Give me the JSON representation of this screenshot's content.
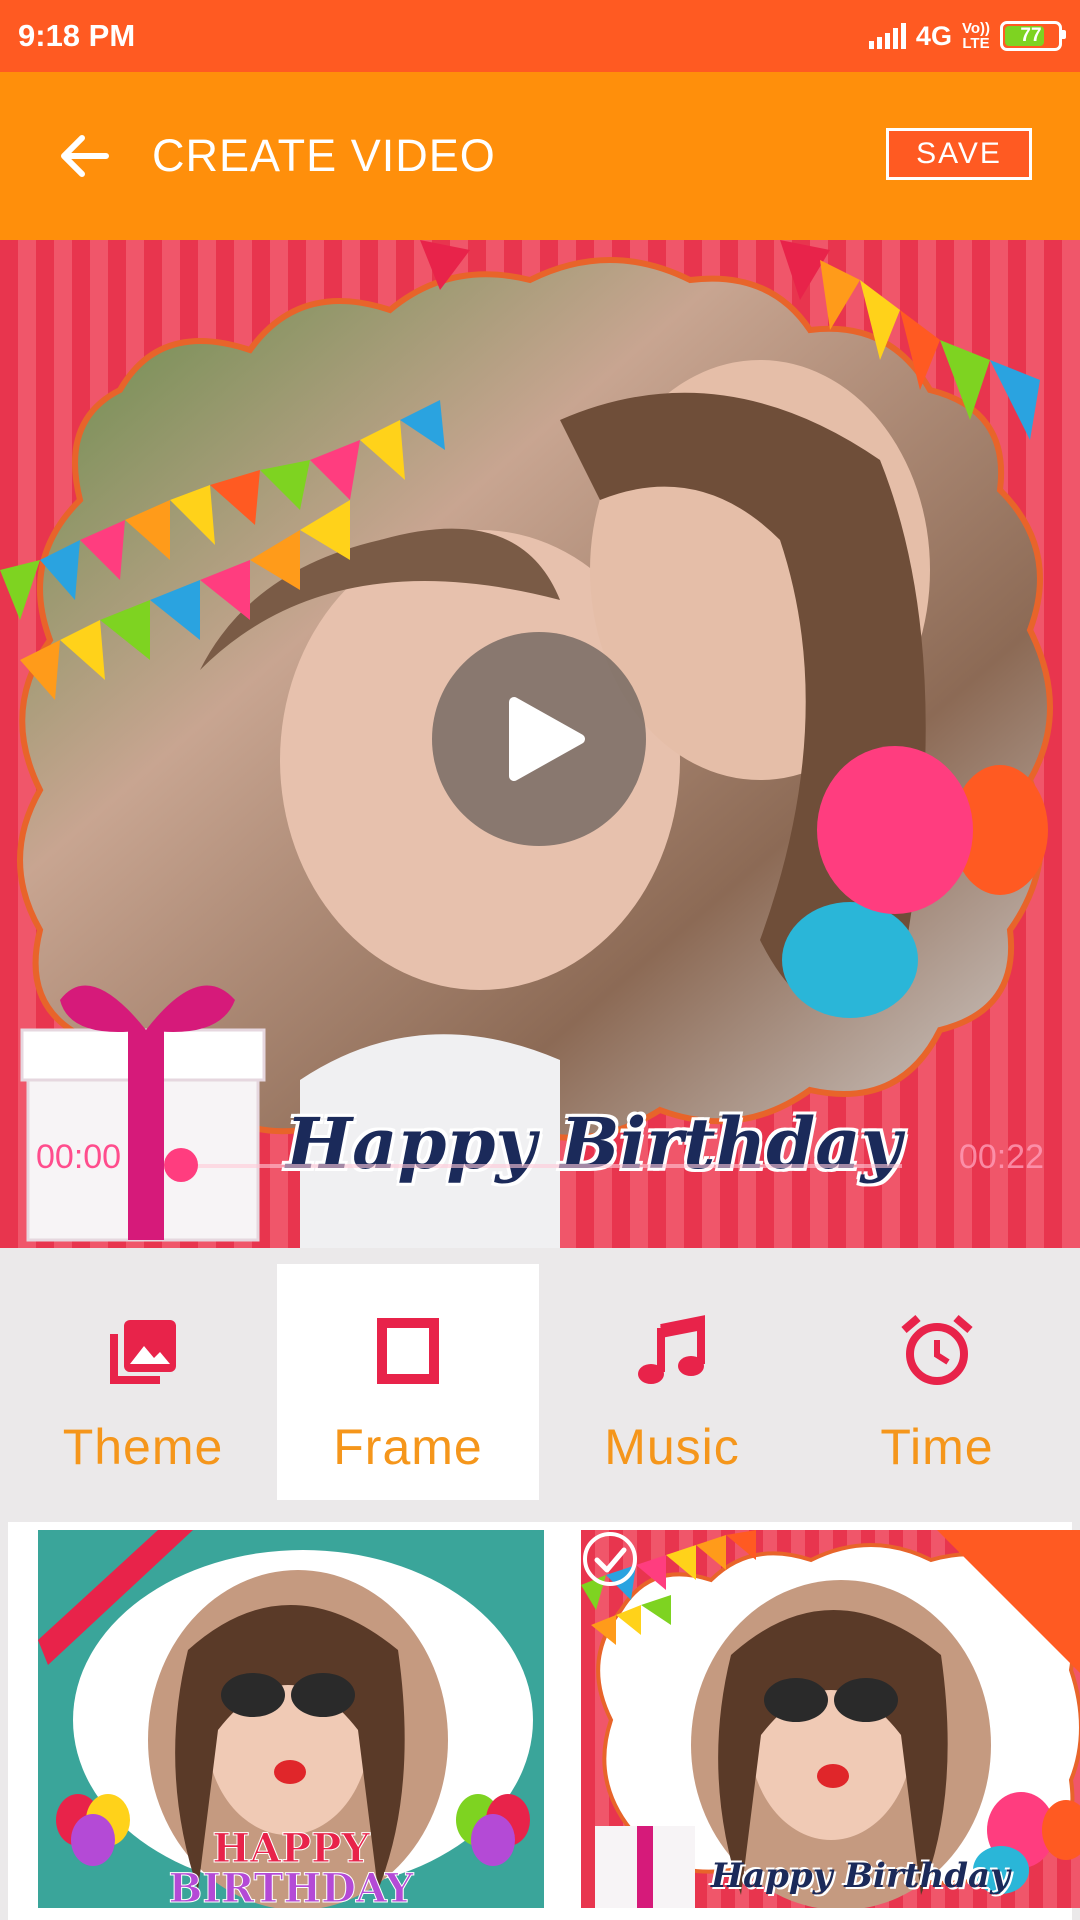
{
  "status_bar": {
    "time": "9:18 PM",
    "network": "4G",
    "volte": "Vo)) LTE",
    "battery": "77",
    "battery_level": 0.77
  },
  "app_bar": {
    "title": "CREATE VIDEO",
    "save_label": "SAVE",
    "back_icon": "arrow-left-icon"
  },
  "player": {
    "current_time": "00:00",
    "total_time": "00:22",
    "play_icon": "play-icon",
    "overlay_text": "Happy Birthday",
    "progress": 0.0
  },
  "tabs": [
    {
      "label": "Theme",
      "icon": "photo-library-icon",
      "active": false
    },
    {
      "label": "Frame",
      "icon": "frame-icon",
      "active": true
    },
    {
      "label": "Music",
      "icon": "music-note-icon",
      "active": false
    },
    {
      "label": "Time",
      "icon": "alarm-clock-icon",
      "active": false
    }
  ],
  "frames": [
    {
      "name": "birthday-ribbon-frame",
      "text_line1": "HAPPY",
      "text_line2": "BIRTHDAY",
      "selected": false
    },
    {
      "name": "birthday-bunting-frame",
      "text": "Happy Birthday",
      "selected": true,
      "check_icon": "check-circle-icon"
    }
  ],
  "colors": {
    "status_bar": "#ff5a22",
    "app_bar": "#ff8f0b",
    "accent_icon": "#e8234a",
    "tab_label": "#f5961b"
  }
}
